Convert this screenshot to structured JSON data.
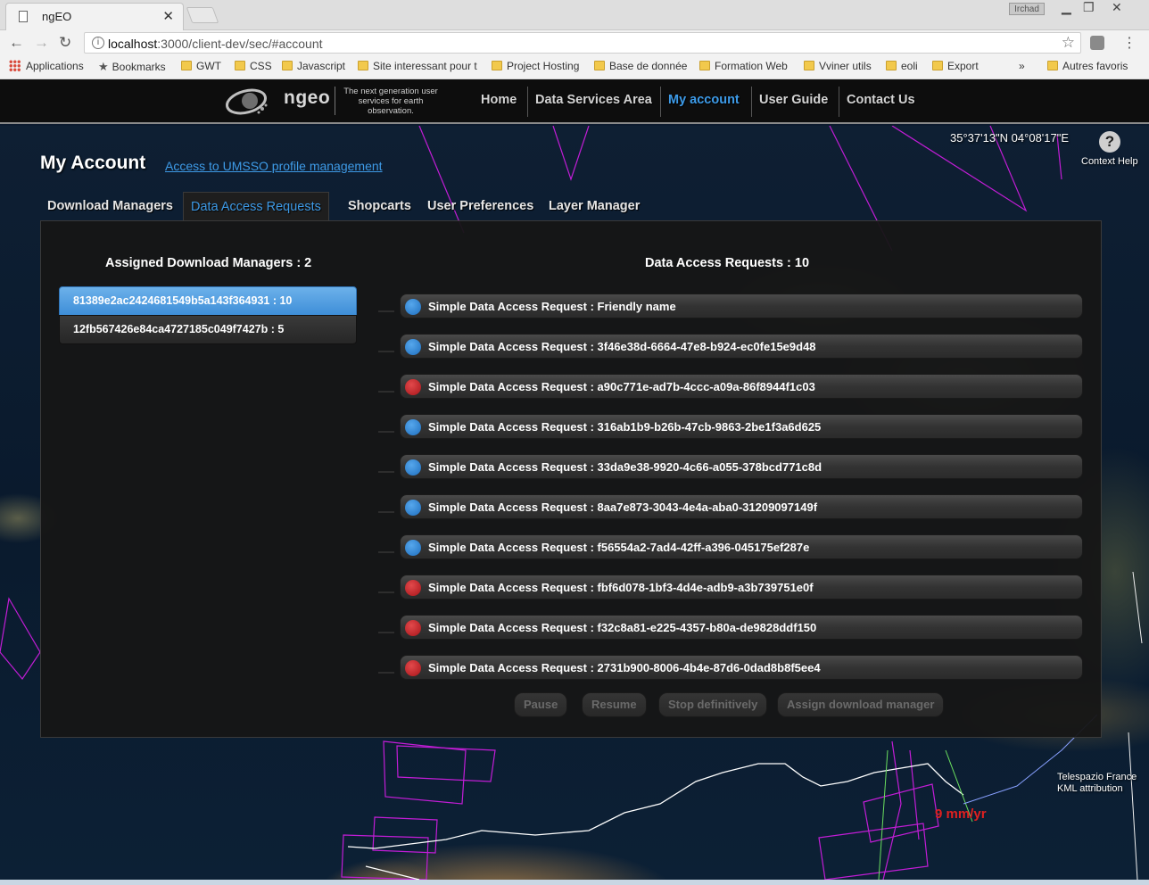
{
  "browser": {
    "tab_title": "ngEO",
    "tab_close": "✕",
    "user_badge": "Irchad",
    "url_prefix": "localhost",
    "url_rest": ":3000/client-dev/sec/#account",
    "bookmarks": [
      "Applications",
      "Bookmarks",
      "GWT",
      "CSS",
      "Javascript",
      "Site interessant pour t",
      "Project Hosting",
      "Base de donnée",
      "Formation Web",
      "Vviner utils",
      "eoli",
      "Export"
    ],
    "more_bookmarks": "»",
    "other_bookmarks": "Autres favoris"
  },
  "header": {
    "logo_text": "ngeo",
    "tagline": "The next generation user services for earth observation.",
    "nav": [
      "Home",
      "Data Services Area",
      "My account",
      "User Guide",
      "Contact Us"
    ],
    "active_nav": "My account"
  },
  "map": {
    "coords": "35°37'13\"N 04°08'17\"E",
    "context_help": "Context Help",
    "attribution_line1": "Telespazio France",
    "attribution_line2": "KML attribution",
    "rate_label": "9 mm/yr"
  },
  "account": {
    "title": "My Account",
    "umsso_link": "Access to UMSSO profile management",
    "tabs": [
      "Download Managers",
      "Data Access Requests",
      "Shopcarts",
      "User Preferences",
      "Layer Manager"
    ],
    "active_tab": "Data Access Requests",
    "dm_heading": "Assigned Download Managers : 2",
    "download_managers": [
      {
        "label": "81389e2ac2424681549b5a143f364931 : 10",
        "selected": true
      },
      {
        "label": "12fb567426e84ca4727185c049f7427b : 5",
        "selected": false
      }
    ],
    "dar_heading": "Data Access Requests : 10",
    "requests": [
      {
        "label": "Simple Data Access Request : Friendly name",
        "status": "blue"
      },
      {
        "label": "Simple Data Access Request : 3f46e38d-6664-47e8-b924-ec0fe15e9d48",
        "status": "blue"
      },
      {
        "label": "Simple Data Access Request : a90c771e-ad7b-4ccc-a09a-86f8944f1c03",
        "status": "red"
      },
      {
        "label": "Simple Data Access Request : 316ab1b9-b26b-47cb-9863-2be1f3a6d625",
        "status": "blue"
      },
      {
        "label": "Simple Data Access Request : 33da9e38-9920-4c66-a055-378bcd771c8d",
        "status": "blue"
      },
      {
        "label": "Simple Data Access Request : 8aa7e873-3043-4e4a-aba0-31209097149f",
        "status": "blue"
      },
      {
        "label": "Simple Data Access Request : f56554a2-7ad4-42ff-a396-045175ef287e",
        "status": "blue"
      },
      {
        "label": "Simple Data Access Request : fbf6d078-1bf3-4d4e-adb9-a3b739751e0f",
        "status": "red"
      },
      {
        "label": "Simple Data Access Request : f32c8a81-e225-4357-b80a-de9828ddf150",
        "status": "red"
      },
      {
        "label": "Simple Data Access Request : 2731b900-8006-4b4e-87d6-0dad8b8f5ee4",
        "status": "red"
      }
    ],
    "actions": [
      "Pause",
      "Resume",
      "Stop definitively",
      "Assign download manager"
    ]
  },
  "colors": {
    "accent_blue": "#3e9ae6",
    "status_blue": "#2a7fcf",
    "status_red": "#c8262b",
    "panel_bg": "#161616"
  }
}
